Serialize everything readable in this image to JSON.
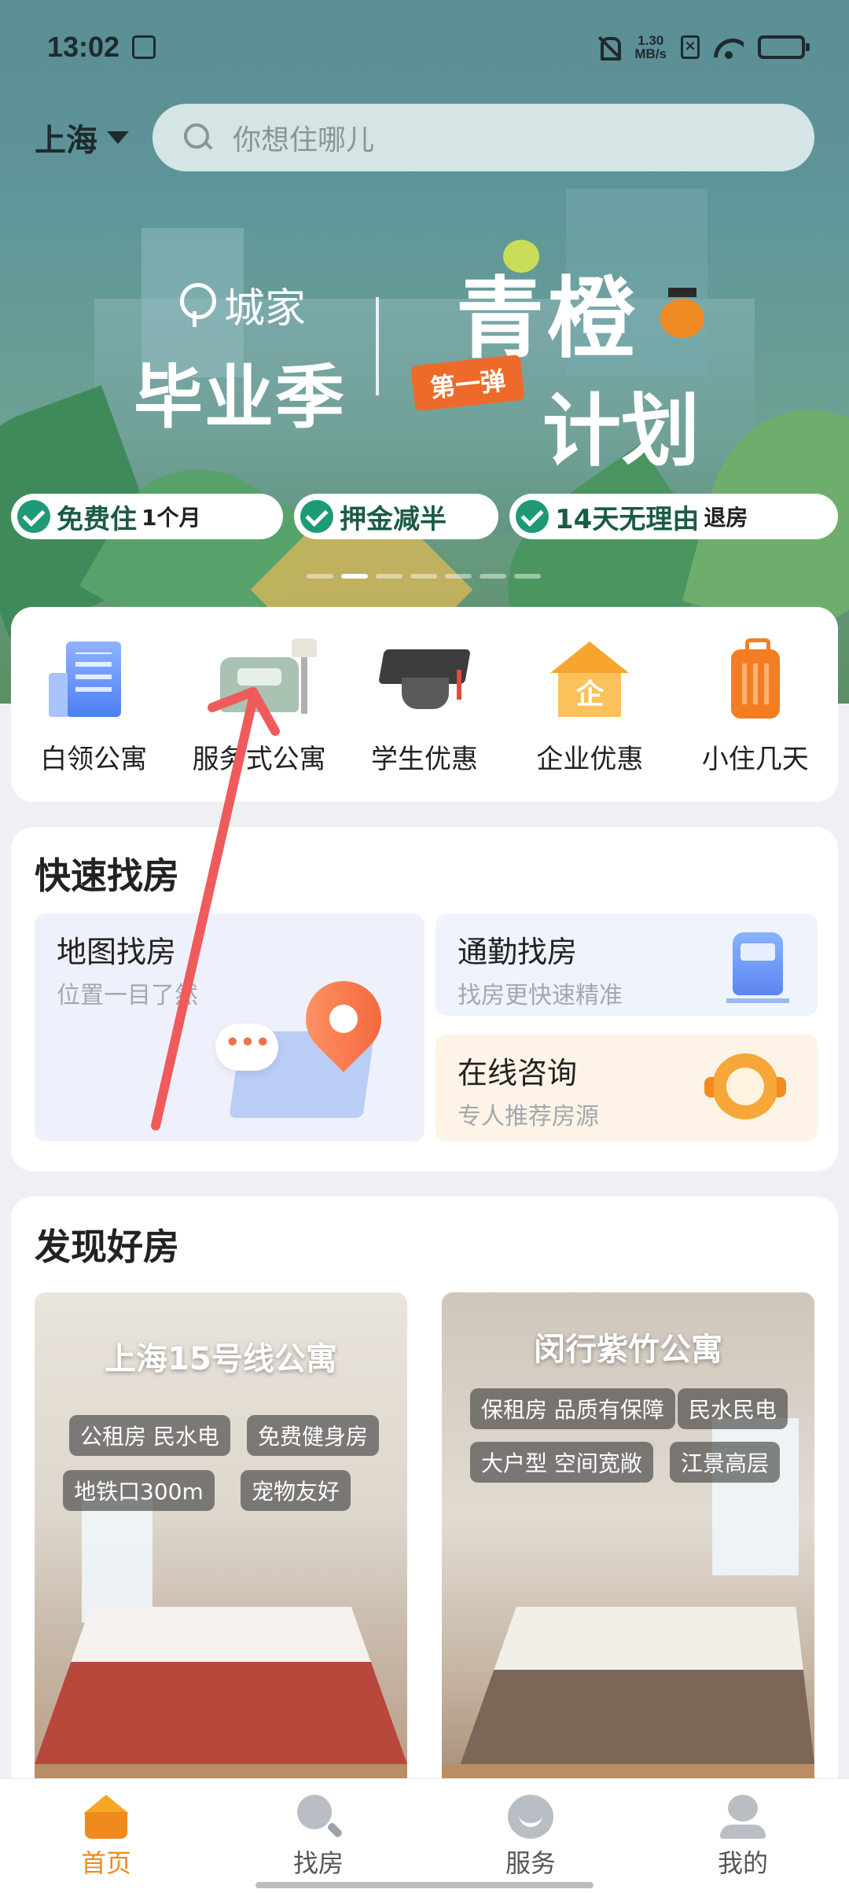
{
  "status_bar": {
    "time": "13:02",
    "net_speed_value": "1.30",
    "net_speed_unit": "MB/s"
  },
  "header": {
    "city": "上海",
    "search_placeholder": "你想住哪儿"
  },
  "banner": {
    "brand": "城家",
    "campaign": "毕业季",
    "title": "青橙",
    "title2": "计划",
    "batch_tag": "第一弹",
    "perks": [
      {
        "main": "免费住",
        "sub": "1个月"
      },
      {
        "main": "押金减半",
        "sub": ""
      },
      {
        "main": "14天无理由",
        "sub": "退房"
      }
    ],
    "dots_total": 7,
    "dots_active": 2
  },
  "categories": [
    {
      "label": "白领公寓",
      "icon": "office-building-icon"
    },
    {
      "label": "服务式公寓",
      "icon": "sofa-lamp-icon"
    },
    {
      "label": "学生优惠",
      "icon": "graduation-cap-icon"
    },
    {
      "label": "企业优惠",
      "icon": "enterprise-house-icon"
    },
    {
      "label": "小住几天",
      "icon": "luggage-icon"
    }
  ],
  "quick_find": {
    "title": "快速找房",
    "map": {
      "title": "地图找房",
      "subtitle": "位置一目了然"
    },
    "commute": {
      "title": "通勤找房",
      "subtitle": "找房更快速精准"
    },
    "consult": {
      "title": "在线咨询",
      "subtitle": "专人推荐房源"
    }
  },
  "discover": {
    "title": "发现好房",
    "listings": [
      {
        "name": "上海15号线公寓",
        "tags": [
          "公租房 民水电",
          "免费健身房",
          "地铁口300m",
          "宠物友好"
        ]
      },
      {
        "name": "闵行紫竹公寓",
        "tags": [
          "保租房 品质有保障",
          "民水民电",
          "大户型 空间宽敞",
          "江景高层"
        ]
      }
    ]
  },
  "bottom_nav": {
    "items": [
      {
        "label": "首页",
        "icon": "home-icon",
        "active": true
      },
      {
        "label": "找房",
        "icon": "search-icon",
        "active": false
      },
      {
        "label": "服务",
        "icon": "service-icon",
        "active": false
      },
      {
        "label": "我的",
        "icon": "profile-icon",
        "active": false
      }
    ]
  },
  "colors": {
    "accent": "#f08a1f",
    "banner_teal": "#5f9699",
    "perk_green": "#1e9a77",
    "annotation_arrow": "#ef5b5b"
  }
}
